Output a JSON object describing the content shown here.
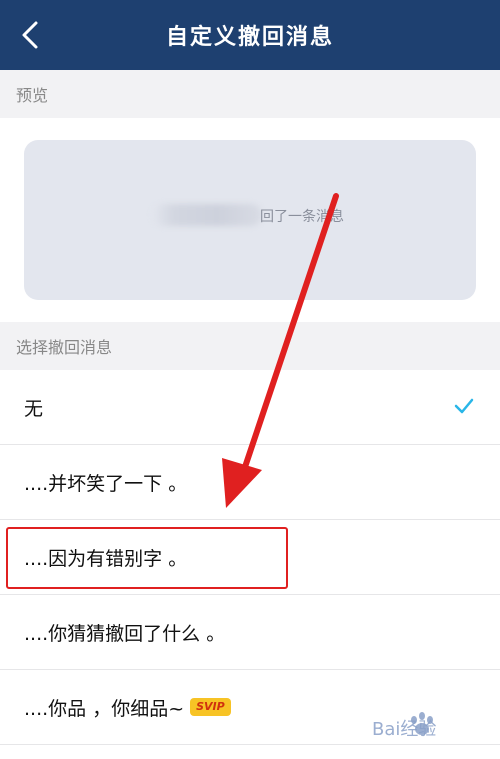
{
  "header": {
    "title": "自定义撤回消息"
  },
  "preview": {
    "section_label": "预览",
    "message_text": "回了一条消息"
  },
  "options": {
    "section_label": "选择撤回消息",
    "items": [
      {
        "label": "无",
        "selected": true
      },
      {
        "label": "....并坏笑了一下 。",
        "selected": false
      },
      {
        "label": "....因为有错别字 。",
        "selected": false
      },
      {
        "label": "....你猜猜撤回了什么 。",
        "selected": false
      },
      {
        "label": "....你品 ，你细品~",
        "selected": false,
        "badge": "SVIP"
      }
    ]
  },
  "colors": {
    "header_bg": "#1e4070",
    "accent_check": "#29b6e8",
    "annotation_red": "#e02020",
    "svip_bg": "#f7c325"
  },
  "watermark": {
    "text": "Bai经验"
  }
}
